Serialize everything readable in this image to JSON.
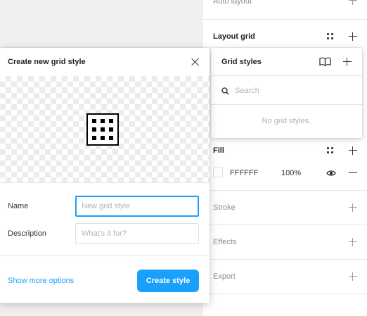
{
  "properties_panel": {
    "auto_layout": {
      "title": "Auto layout"
    },
    "layout_grid": {
      "title": "Layout grid"
    },
    "fill": {
      "title": "Fill",
      "swatch_color": "#FFFFFF",
      "hex": "FFFFFF",
      "opacity": "100%"
    },
    "stroke": {
      "title": "Stroke"
    },
    "effects": {
      "title": "Effects"
    },
    "export": {
      "title": "Export"
    }
  },
  "grid_styles_popover": {
    "title": "Grid styles",
    "search_placeholder": "Search",
    "empty_text": "No grid styles."
  },
  "create_dialog": {
    "title": "Create new grid style",
    "name_label": "Name",
    "name_placeholder": "New grid style",
    "name_value": "",
    "description_label": "Description",
    "description_placeholder": "What's it for?",
    "description_value": "",
    "show_more_label": "Show more options",
    "create_button_label": "Create style"
  },
  "colors": {
    "accent": "#18A0FB",
    "panel_bg": "#FFFFFF",
    "canvas_bg": "#F0F0F0"
  },
  "icons": {
    "close": "close-icon",
    "library": "book-icon",
    "add": "plus-icon",
    "search": "search-icon",
    "grid_style_preview": "grid-icon",
    "styles": "four-dots-icon",
    "visibility": "eye-icon",
    "remove": "minus-icon"
  }
}
